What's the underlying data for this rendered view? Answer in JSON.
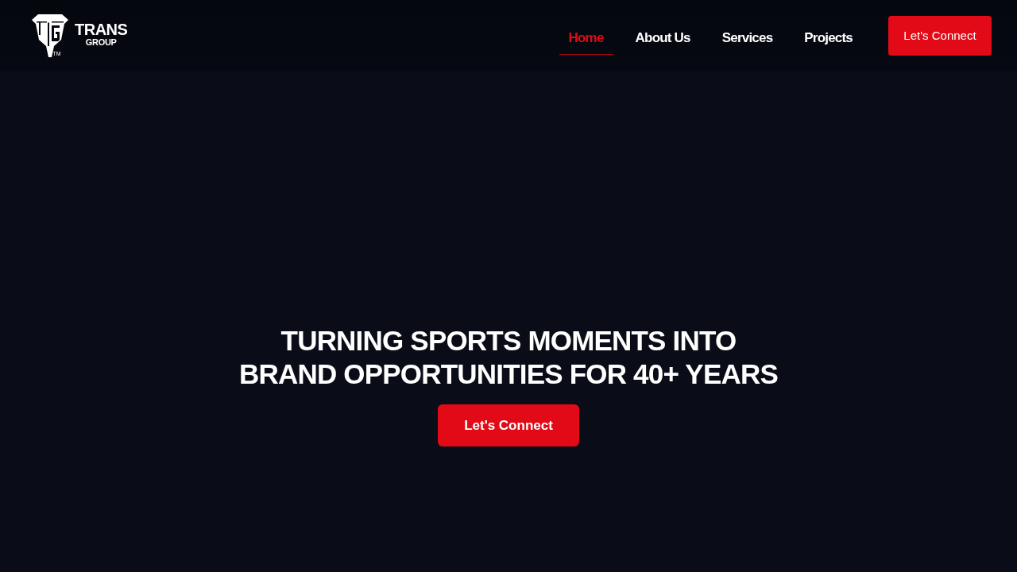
{
  "header": {
    "logo": {
      "name": "TRANS",
      "subtitle": "GROUP",
      "trademark": "TM"
    },
    "nav": [
      {
        "label": "Home",
        "selected": true
      },
      {
        "label": "About Us",
        "selected": false
      },
      {
        "label": "Services",
        "selected": false
      },
      {
        "label": "Projects",
        "selected": false
      }
    ],
    "cta": "Let's Connect"
  },
  "hero": {
    "headline": [
      "TURNING SPORTS MOMENTS INTO",
      "BRAND OPPORTUNITIES FOR 40+ YEARS"
    ],
    "button": "Let's Connect"
  }
}
